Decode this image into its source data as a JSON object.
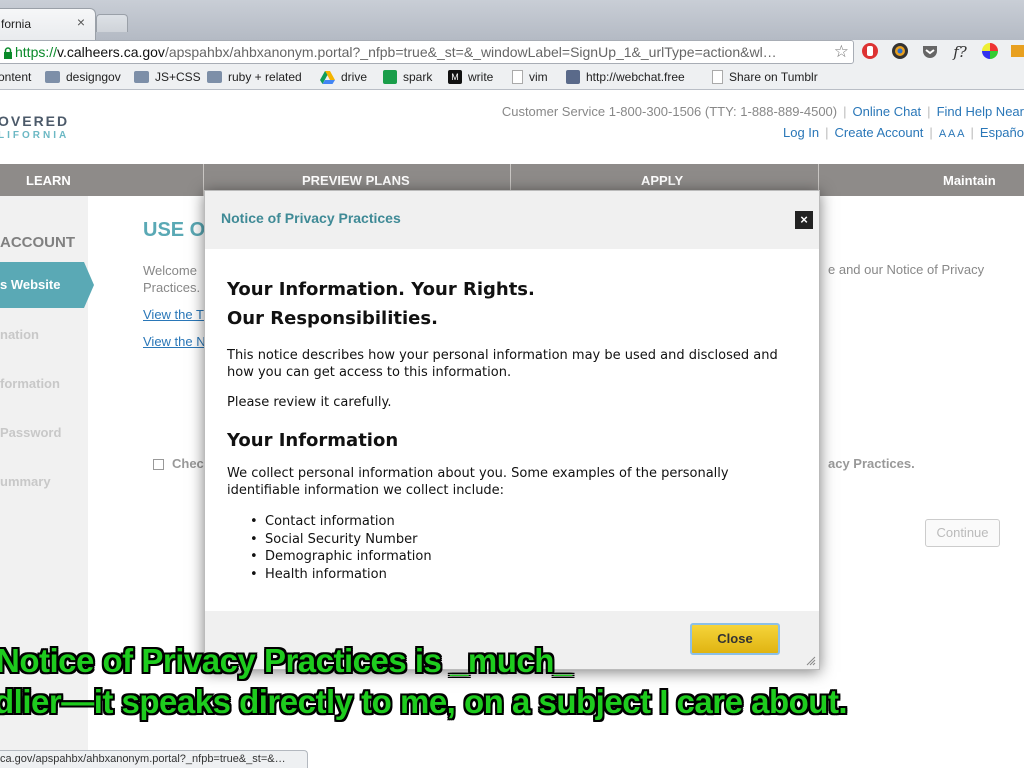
{
  "browser": {
    "tab_title": "fornia",
    "tab_close": "×",
    "url_scheme": "https://",
    "url_host": "v.calheers.ca.gov",
    "url_path": "/apspahbx/ahbxanonym.portal?_nfpb=true&_st=&_windowLabel=SignUp_1&_urlType=action&wl…",
    "star": "☆",
    "extensions": [
      "hand-icon",
      "color-wheel-icon",
      "pocket-icon",
      "font-icon",
      "color-picker-icon"
    ],
    "ext_font_label": "f?",
    "status_url": "ca.gov/apspahbx/ahbxanonym.portal?_nfpb=true&_st=&…"
  },
  "bookmarks": [
    {
      "label": "ontent",
      "icon": "none"
    },
    {
      "label": "designgov",
      "icon": "folder-icon"
    },
    {
      "label": "JS+CSS",
      "icon": "folder-icon"
    },
    {
      "label": "ruby + related",
      "icon": "folder-icon"
    },
    {
      "label": "drive",
      "icon": "drive-icon"
    },
    {
      "label": "spark",
      "icon": "sheet-icon"
    },
    {
      "label": "write",
      "icon": "m-icon"
    },
    {
      "label": "vim",
      "icon": "page-icon"
    },
    {
      "label": "http://webchat.free",
      "icon": "globe-icon"
    },
    {
      "label": "Share on Tumblr",
      "icon": "page-icon"
    }
  ],
  "site": {
    "logo_top": "OVERED",
    "logo_bottom": "LIFORNIA",
    "customer_service": "Customer Service 1-800-300-1506 (TTY: 1-888-889-4500)",
    "online_chat": "Online Chat",
    "find_help": "Find Help Near",
    "log_in": "Log In",
    "create_account": "Create Account",
    "font_size": "A A A",
    "espanol": "Españo",
    "nav": [
      "LEARN",
      "PREVIEW PLANS",
      "APPLY",
      "Maintain"
    ]
  },
  "sidebar": {
    "title": "ACCOUNT",
    "active": "s Website",
    "items": [
      "nation",
      "formation",
      "Password",
      "ummary"
    ]
  },
  "main": {
    "title": "USE O",
    "welcome_line1": "Welcome",
    "welcome_line2": "Practices.",
    "right_text": "e and our Notice of Privacy",
    "link1": "View the T",
    "link2": "View the N",
    "check_label": "Chec",
    "check_right": "acy Practices.",
    "continue": "Continue"
  },
  "modal": {
    "title": "Notice of Privacy Practices",
    "close_x": "×",
    "heading1": "Your Information. Your Rights.",
    "heading2": "Our Responsibilities.",
    "para1": "This notice describes how your personal information may be used and disclosed and how you can get access to this information.",
    "para2": "Please review it carefully.",
    "section_heading": "Your Information",
    "para3": "We collect personal information about you. Some examples of the personally identifiable information we collect include:",
    "list": [
      "Contact information",
      "Social Security Number",
      "Demographic information",
      "Health information"
    ],
    "close_button": "Close"
  },
  "caption": {
    "line1": "Notice of Privacy Practices is _much_",
    "line2": "dlier—it speaks directly to me, on a subject I care about."
  }
}
